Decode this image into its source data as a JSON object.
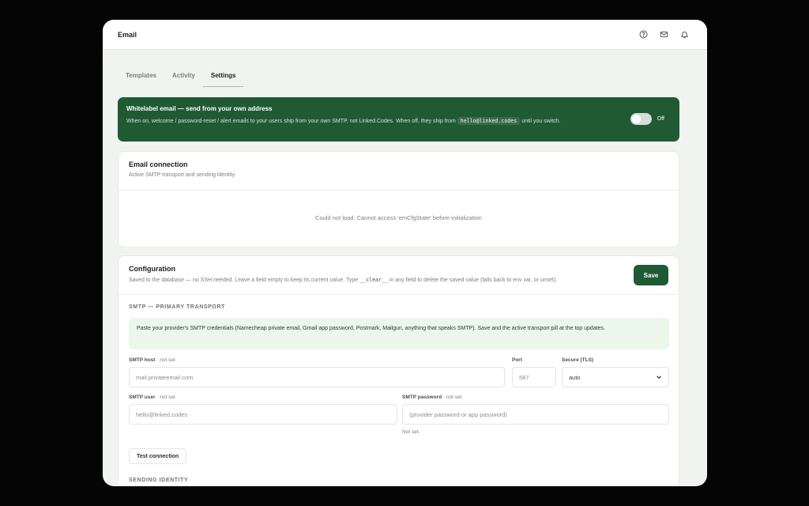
{
  "topbar": {
    "title": "Email",
    "icons": [
      "help-icon",
      "mail-icon",
      "bell-icon"
    ]
  },
  "tabs": [
    {
      "label": "Templates",
      "active": false
    },
    {
      "label": "Activity",
      "active": false
    },
    {
      "label": "Settings",
      "active": true
    }
  ],
  "banner": {
    "title": "Whitelabel email — send from your own address",
    "desc_before": "When on, welcome / password-reset / alert emails to your users ship from your own SMTP, not Linked.Codes. When off, they ship from",
    "code": "hello@linked.codes",
    "desc_after": "until you switch.",
    "toggle_label": "Off",
    "toggle_on": false
  },
  "connection": {
    "title": "Email connection",
    "subtitle": "Active SMTP transport and sending identity.",
    "error": "Could not load: Cannot access 'emCfgState' before initialization"
  },
  "config": {
    "title": "Configuration",
    "subtitle_before": "Saved to the database — no SSH needed. Leave a field empty to keep its current value. Type",
    "subtitle_code": "__clear__",
    "subtitle_after": "in any field to delete the saved value (falls back to env var, or unset).",
    "save_label": "Save",
    "smtp_section": "SMTP — PRIMARY TRANSPORT",
    "info": "Paste your provider's SMTP credentials (Namecheap private email, Gmail app password, Postmark, Mailgun, anything that speaks SMTP). Save and the active transport pill at the top updates.",
    "host_label": "SMTP host",
    "host_status": " · not set",
    "host_placeholder": "mail.privateemail.com",
    "port_label": "Port",
    "port_placeholder": "587",
    "secure_label": "Secure (TLS)",
    "secure_value": "auto",
    "user_label": "SMTP user",
    "user_status": " · not set",
    "user_placeholder": "hello@linked.codes",
    "password_label": "SMTP password",
    "password_status": " · not set",
    "password_placeholder": "(provider password or app password)",
    "password_hint": "Not set.",
    "test_label": "Test connection",
    "identity_section": "SENDING IDENTITY"
  },
  "colors": {
    "accent": "#1f5a33",
    "info_bg": "#eaf7ea"
  }
}
